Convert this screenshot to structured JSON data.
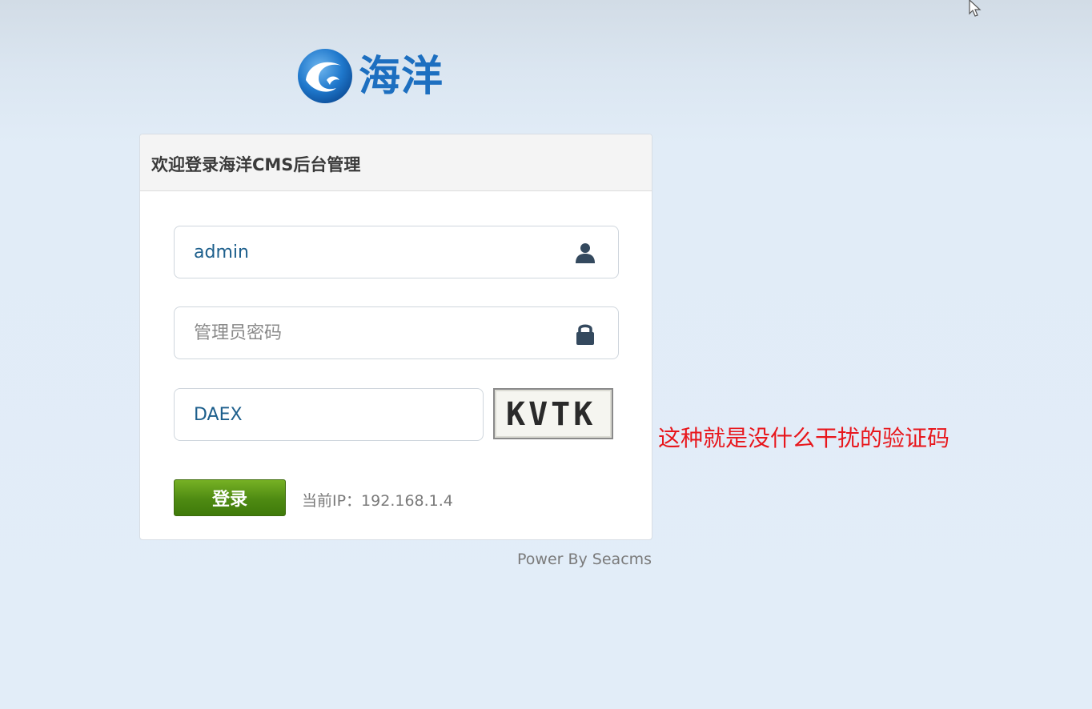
{
  "logo": {
    "text": "海洋",
    "icon": "wave-logo-icon"
  },
  "panel": {
    "title": "欢迎登录海洋CMS后台管理"
  },
  "form": {
    "username": {
      "value": "admin",
      "icon": "user-icon"
    },
    "password": {
      "placeholder": "管理员密码",
      "value": "",
      "icon": "lock-icon"
    },
    "captcha": {
      "value": "DAEX",
      "image_text": "KVTK"
    },
    "login_label": "登录",
    "ip_label": "当前IP：192.168.1.4"
  },
  "footer": {
    "credit": "Power By Seacms"
  },
  "annotation": {
    "text": "这种就是没什么干扰的验证码"
  },
  "colors": {
    "brand_blue": "#1d6fc0",
    "login_button_green": "#4e8a12",
    "annotation_red": "#e8161c",
    "input_text": "#1d5f8c"
  }
}
